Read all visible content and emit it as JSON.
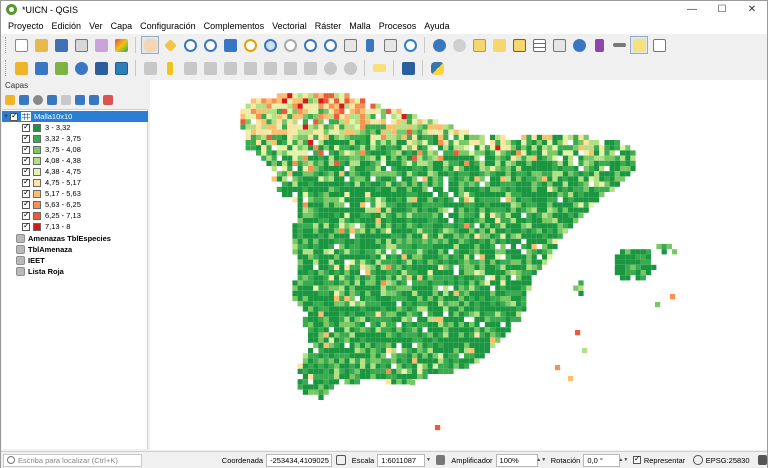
{
  "window": {
    "title": "*UICN - QGIS",
    "controls": [
      "—",
      "☐",
      "✕"
    ]
  },
  "menubar": [
    "Proyecto",
    "Edición",
    "Ver",
    "Capa",
    "Configuración",
    "Complementos",
    "Vectorial",
    "Ráster",
    "Malla",
    "Procesos",
    "Ayuda"
  ],
  "layers_panel": {
    "title": "Capas",
    "active_layer": {
      "name": "Malla10x10",
      "checked": true,
      "expanded": true
    },
    "legend": [
      {
        "label": "3 - 3,32",
        "color": "#1a9641"
      },
      {
        "label": "3,32 - 3,75",
        "color": "#3bab4f"
      },
      {
        "label": "3,75 - 4,08",
        "color": "#79c865"
      },
      {
        "label": "4,08 - 4,38",
        "color": "#b3e085"
      },
      {
        "label": "4,38 - 4,75",
        "color": "#e3f3a8"
      },
      {
        "label": "4,75 - 5,17",
        "color": "#fee3a1"
      },
      {
        "label": "5,17 - 5,63",
        "color": "#fdbf6f"
      },
      {
        "label": "5,63 - 6,25",
        "color": "#f99153"
      },
      {
        "label": "6,25 - 7,13",
        "color": "#ec5a3a"
      },
      {
        "label": "7,13 - 8",
        "color": "#d7191c"
      }
    ],
    "groups": [
      "Amenazas TblEspecies",
      "TblAmenaza",
      "IEET",
      "Lista Roja"
    ]
  },
  "statusbar": {
    "locator_placeholder": "Escriba para localizar (Ctrl+K)",
    "coordinate_label": "Coordenada",
    "coordinate_value": "-253434,4109025",
    "scale_label": "Escala",
    "scale_value": "1:6011087",
    "magnifier_label": "Amplificador",
    "magnifier_value": "100%",
    "rotation_label": "Rotación",
    "rotation_value": "0,0 °",
    "render_label": "Representar",
    "render_checked": true,
    "crs_label": "EPSG:25830"
  }
}
